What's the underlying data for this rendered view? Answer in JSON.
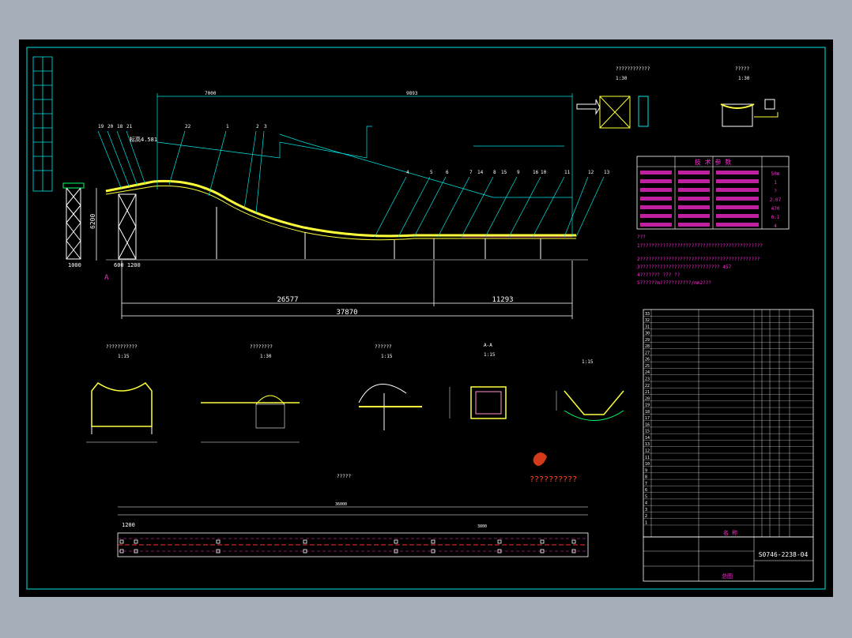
{
  "colors": {
    "cyan": "#00e5e5",
    "magenta": "#ff2bd6",
    "yellow": "#ffff3a",
    "white": "#ffffff",
    "red": "#ff3030",
    "pink": "#ff8fd0",
    "green": "#00ff66"
  },
  "drawing": {
    "drawing_number": "S0746-2238-04",
    "total_dim": "37870",
    "left_dim": "26577",
    "right_dim": "11293",
    "height_dim": "6200",
    "tower_base": "1000",
    "base_dims": "600 1200",
    "elev_label": "标高4.581",
    "top_dim_1": "7000",
    "top_dim_2": "9893",
    "section_a": "A",
    "view_scale_1": "1:30",
    "view_scale_2": "1:30",
    "detail_scale_1": "1:15",
    "detail_scale_2": "1:30",
    "detail_scale_3": "1:15",
    "detail_scale_4": "1:15",
    "detail_scale_5": "1:15",
    "section_label": "A-A",
    "foundation_dim": "1200",
    "foundation_dim_2": "3800",
    "foundation_total": "36000",
    "foundation_qmarks": "?????",
    "watermark_text": "??????????",
    "title_label": "总图",
    "spec_header": "技 术 参 数",
    "spec_values": [
      "50m",
      "1",
      "?",
      "2.07",
      "470",
      "0.1",
      "4"
    ],
    "notes": [
      "???",
      "1???????????????????????????????????????????",
      "2??????????????????????????????????????????",
      "3???????????????????????????? 457",
      "4??????? ??? ??",
      "5??????m???????????/mm2???"
    ],
    "bom_rows": [
      "33",
      "32",
      "31",
      "30",
      "29",
      "28",
      "27",
      "26",
      "25",
      "24",
      "23",
      "22",
      "21",
      "20",
      "19",
      "18",
      "17",
      "16",
      "15",
      "14",
      "13",
      "12",
      "11",
      "10",
      "9",
      "8",
      "7",
      "6",
      "5",
      "4",
      "3",
      "2",
      "1"
    ],
    "bom_footer": "名 称",
    "pos_numbers": [
      "19",
      "20",
      "18",
      "21",
      "22",
      "1",
      "2",
      "3",
      "4",
      "5",
      "6",
      "7",
      "8",
      "9",
      "10",
      "11",
      "12",
      "13",
      "14",
      "15",
      "16"
    ],
    "qmark_title_1": "????????????",
    "qmark_title_2": "?????",
    "qmark_title_3": "???????????",
    "qmark_title_4": "????????",
    "qmark_title_5": "??????"
  }
}
